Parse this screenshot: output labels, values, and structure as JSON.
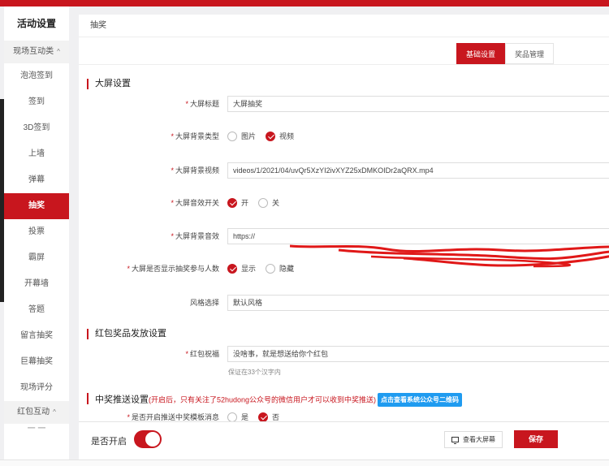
{
  "colors": {
    "brand": "#c8161e",
    "accent_blue": "#1f9bf0"
  },
  "sidebar": {
    "title": "活动设置",
    "group1": "现场互动类",
    "group1_chevron": "^",
    "items": [
      "泡泡签到",
      "签到",
      "3D签到",
      "上墙",
      "弹幕",
      "抽奖",
      "投票",
      "霸屏",
      "开幕墙",
      "答题",
      "留言抽奖",
      "巨幕抽奖",
      "现场评分"
    ],
    "active_index": 5,
    "group2": "红包互动",
    "group2_chevron": "^",
    "cut_item": "一 一"
  },
  "breadcrumb": "抽奖",
  "tabs": [
    {
      "label": "基础设置",
      "active": true
    },
    {
      "label": "奖品管理",
      "active": false
    }
  ],
  "sections": {
    "big_screen": "大屏设置",
    "red_packet": "红包奖品发放设置",
    "push": "中奖推送设置",
    "push_note": "(开启后，只有关注了52hudong公众号的微信用户才可以收到中奖推送)",
    "push_qr_button": "点击查看系统公众号二维码"
  },
  "form": {
    "title_label": "大屏标题",
    "title_value": "大屏抽奖",
    "bg_type_label": "大屏背景类型",
    "bg_type_options": [
      "图片",
      "视频"
    ],
    "bg_type_selected": "视频",
    "bg_video_label": "大屏背景视频",
    "bg_video_value": "videos/1/2021/04/uvQr5XzYI2ivXYZ25xDMKOIDr2aQRX.mp4",
    "sound_switch_label": "大屏音效开关",
    "sound_switch_options": [
      "开",
      "关"
    ],
    "sound_switch_selected": "开",
    "sound_label": "大屏背景音效",
    "sound_value": "https://",
    "show_count_label": "大屏是否显示抽奖参与人数",
    "show_count_options": [
      "显示",
      "隐藏"
    ],
    "show_count_selected": "显示",
    "style_label": "风格选择",
    "style_value": "默认风格",
    "blessing_label": "红包祝福",
    "blessing_value": "没啥事，就是想送给你个红包",
    "blessing_hint": "保证在33个汉字内",
    "push_enable_label": "是否开启推送中奖模板消息",
    "push_enable_options": [
      "是",
      "否"
    ],
    "push_enable_selected": "否",
    "required_mark": "*"
  },
  "bottom": {
    "enable_label": "是否开启",
    "enable_on": true,
    "preview_button": "查看大屏幕",
    "save_button": "保存"
  }
}
